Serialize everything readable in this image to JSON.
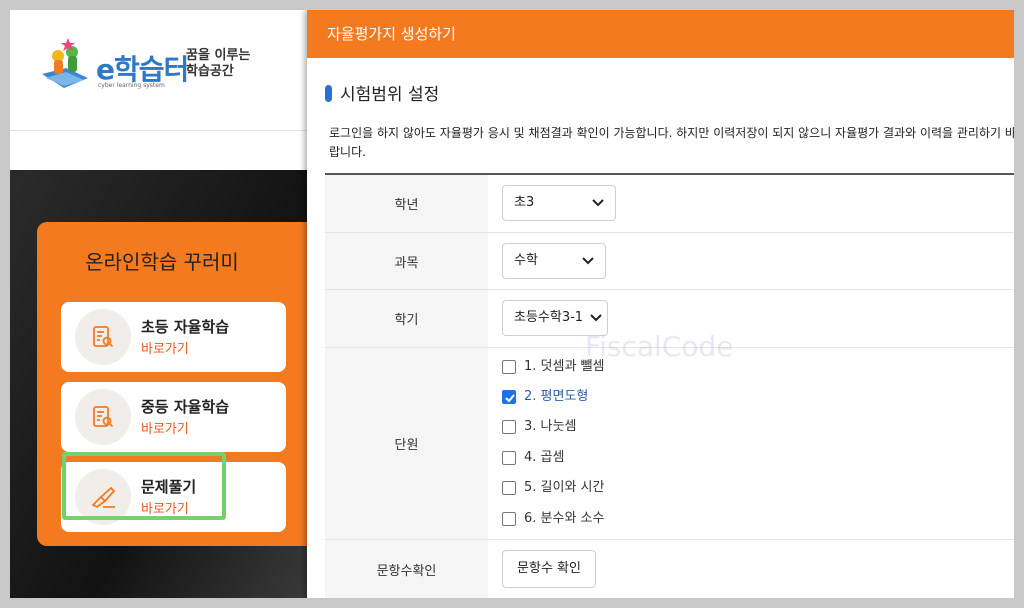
{
  "background_page": {
    "logo": {
      "brand": "e학습터",
      "sub": "cyber learning system",
      "slogan_line1": "꿈을 이루는",
      "slogan_line2": "학습공간"
    },
    "panel": {
      "title": "온라인학습 꾸러미",
      "cards": [
        {
          "title": "초등 자율학습",
          "link": "바로가기"
        },
        {
          "title": "중등 자율학습",
          "link": "바로가기"
        },
        {
          "title": "문제풀기",
          "link": "바로가기"
        }
      ]
    }
  },
  "modal": {
    "title": "자율평가지 생성하기",
    "section_title": "시험범위 설정",
    "notice": "로그인을 하지 않아도 자율평가 응시 및 채점결과 확인이 가능합니다. 하지만 이력저장이 되지 않으니 자율평가 결과와 이력을 관리하기 바랍니다.",
    "form": {
      "grade_label": "학년",
      "grade_value": "초3",
      "subject_label": "과목",
      "subject_value": "수학",
      "term_label": "학기",
      "term_value": "초등수학3-1",
      "unit_label": "단원",
      "units": [
        {
          "label": "1. 덧셈과 뺄셈",
          "checked": false
        },
        {
          "label": "2. 평면도형",
          "checked": true
        },
        {
          "label": "3. 나눗셈",
          "checked": false
        },
        {
          "label": "4. 곱셈",
          "checked": false
        },
        {
          "label": "5. 길이와 시간",
          "checked": false
        },
        {
          "label": "6. 분수와 소수",
          "checked": false
        }
      ],
      "count_label": "문항수확인",
      "count_button": "문항수 확인"
    }
  },
  "watermark": "FiscalCode",
  "colors": {
    "accent": "#f47a20",
    "link": "#e8591c",
    "checkbox": "#1a73e8",
    "highlight": "#74d26c"
  }
}
